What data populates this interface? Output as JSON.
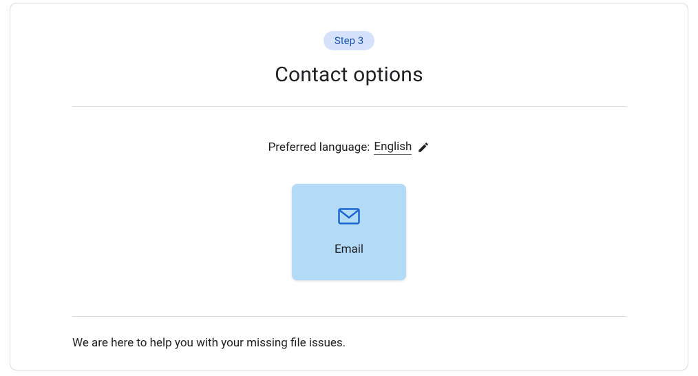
{
  "step_badge": "Step 3",
  "title": "Contact options",
  "language": {
    "label": "Preferred language:",
    "value": "English"
  },
  "options": {
    "email_label": "Email"
  },
  "help_text": "We are here to help you with your missing file issues."
}
